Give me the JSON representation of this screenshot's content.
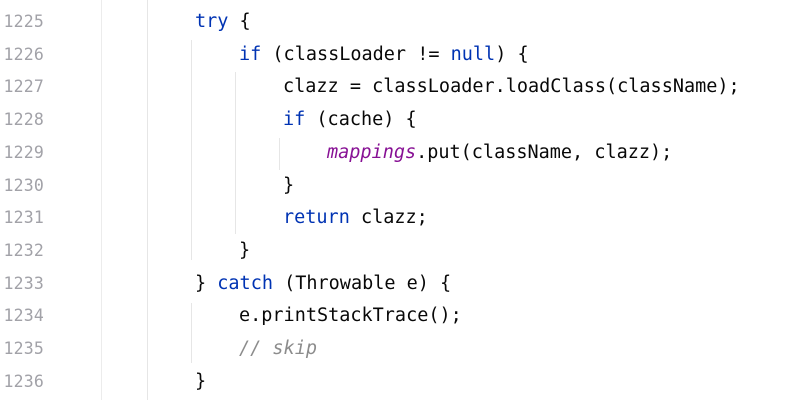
{
  "editor": {
    "lines": [
      {
        "number": "1225",
        "indent": 4,
        "tokens": [
          {
            "t": "kw",
            "v": "try"
          },
          {
            "t": "p",
            "v": " {"
          }
        ]
      },
      {
        "number": "1226",
        "indent": 5,
        "tokens": [
          {
            "t": "kw",
            "v": "if"
          },
          {
            "t": "p",
            "v": " (classLoader != "
          },
          {
            "t": "kw",
            "v": "null"
          },
          {
            "t": "p",
            "v": ") {"
          }
        ]
      },
      {
        "number": "1227",
        "indent": 6,
        "tokens": [
          {
            "t": "p",
            "v": "clazz = classLoader.loadClass(className);"
          }
        ]
      },
      {
        "number": "1228",
        "indent": 6,
        "tokens": [
          {
            "t": "kw",
            "v": "if"
          },
          {
            "t": "p",
            "v": " (cache) {"
          }
        ]
      },
      {
        "number": "1229",
        "indent": 7,
        "tokens": [
          {
            "t": "fld",
            "v": "mappings"
          },
          {
            "t": "p",
            "v": ".put(className, clazz);"
          }
        ]
      },
      {
        "number": "1230",
        "indent": 6,
        "tokens": [
          {
            "t": "p",
            "v": "}"
          }
        ]
      },
      {
        "number": "1231",
        "indent": 6,
        "tokens": [
          {
            "t": "kw",
            "v": "return"
          },
          {
            "t": "p",
            "v": " clazz;"
          }
        ]
      },
      {
        "number": "1232",
        "indent": 5,
        "tokens": [
          {
            "t": "p",
            "v": "}"
          }
        ]
      },
      {
        "number": "1233",
        "indent": 4,
        "tokens": [
          {
            "t": "p",
            "v": "} "
          },
          {
            "t": "kw",
            "v": "catch"
          },
          {
            "t": "p",
            "v": " (Throwable e) {"
          }
        ]
      },
      {
        "number": "1234",
        "indent": 5,
        "tokens": [
          {
            "t": "p",
            "v": "e.printStackTrace();"
          }
        ]
      },
      {
        "number": "1235",
        "indent": 5,
        "tokens": [
          {
            "t": "cmt",
            "v": "// skip"
          }
        ]
      },
      {
        "number": "1236",
        "indent": 4,
        "tokens": [
          {
            "t": "p",
            "v": "}"
          }
        ]
      }
    ]
  },
  "colors": {
    "keyword": "#0033b3",
    "field": "#871094",
    "comment": "#8c8c8c",
    "text": "#080808",
    "line_number": "#a2a2a8"
  }
}
